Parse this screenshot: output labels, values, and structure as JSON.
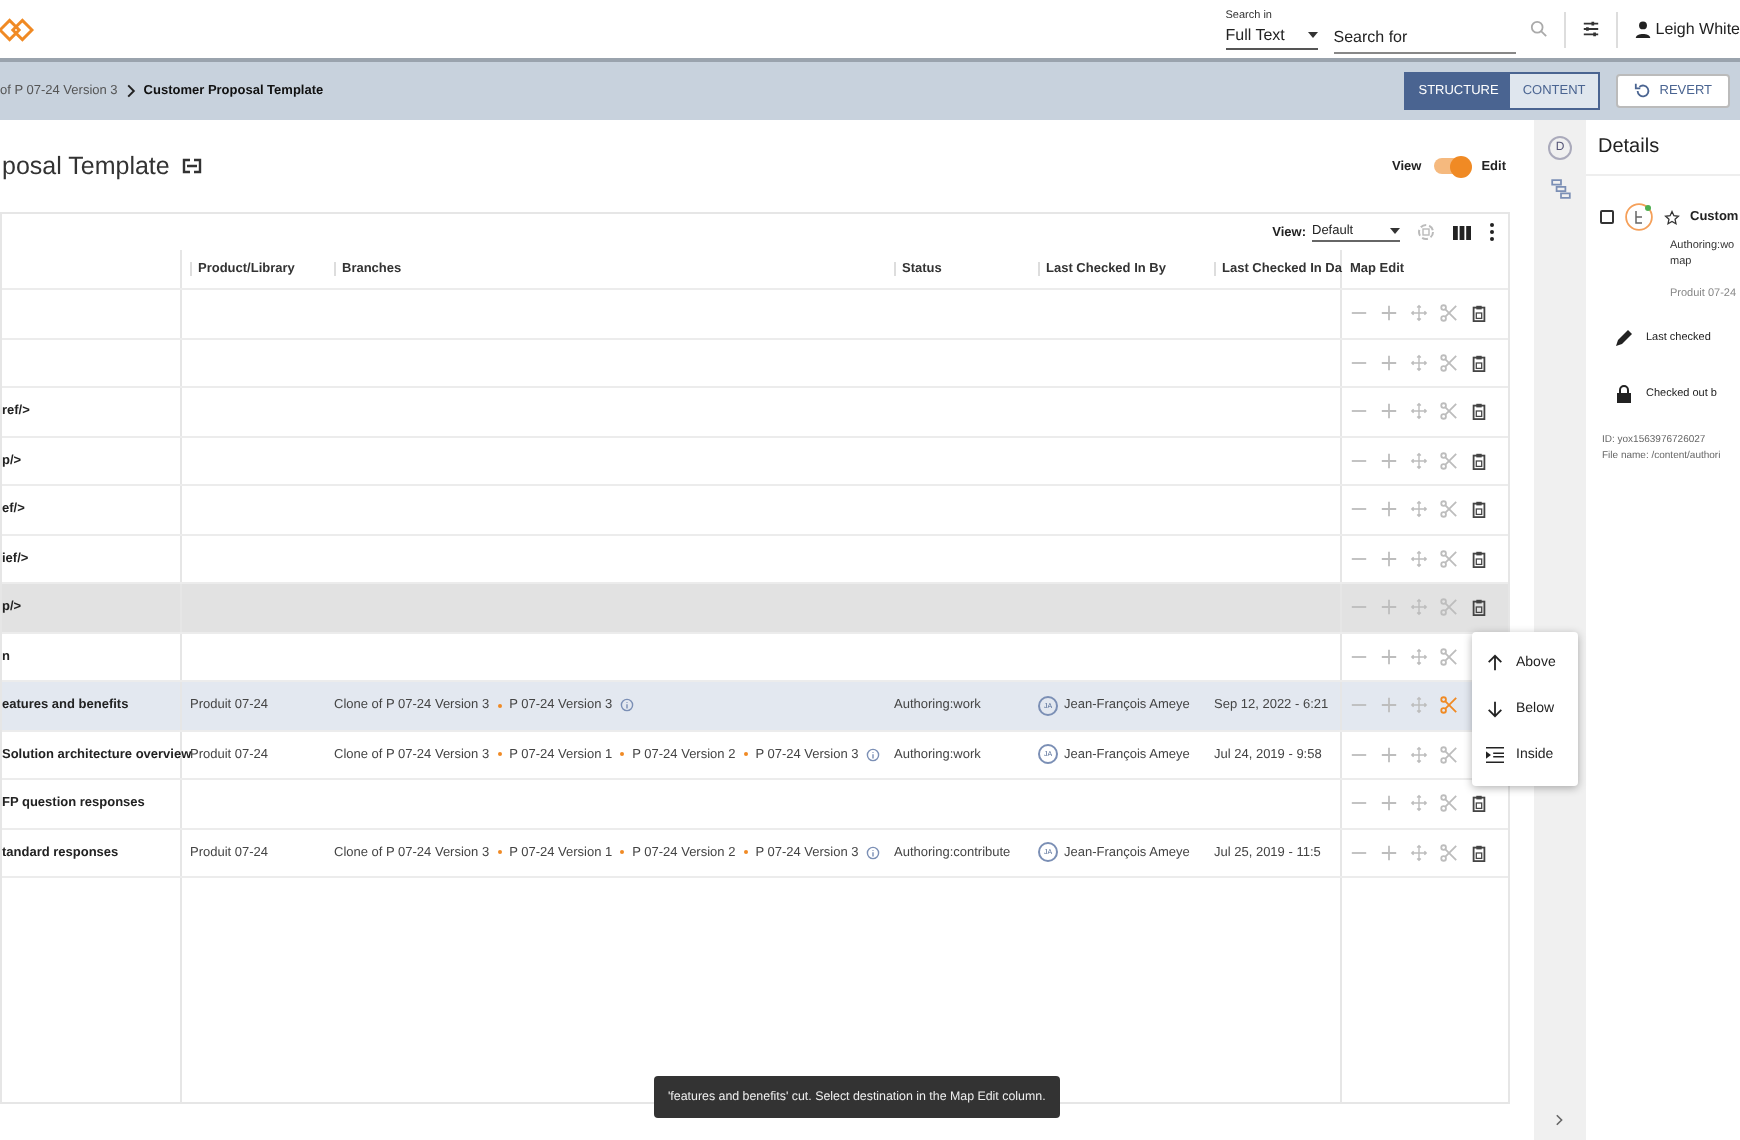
{
  "app_bar": {
    "search_label": "Search in",
    "search_scope": "Full Text",
    "search_placeholder": "Search for",
    "user_name": "Leigh White"
  },
  "breadcrumb": [
    {
      "label": "of P 07-24 Version 3",
      "current": false
    },
    {
      "label": "Customer Proposal Template",
      "current": true
    }
  ],
  "mode_tabs": [
    {
      "label": "STRUCTURE",
      "selected": true
    },
    {
      "label": "CONTENT",
      "selected": false
    }
  ],
  "revert_button": "REVERT",
  "page_title": "posal Template",
  "view_toggle": {
    "left_label": "View",
    "right_label": "Edit",
    "on": true
  },
  "table": {
    "view_label": "View:",
    "view_value": "Default",
    "columns": [
      "Product/Library",
      "Branches",
      "Status",
      "Last Checked In By",
      "Last Checked In Da",
      "Map Edit"
    ],
    "rows": [
      {
        "highlighted": false,
        "selected": false,
        "cut": false
      },
      {
        "highlighted": false,
        "selected": false,
        "cut": false
      },
      {
        "name": "ref/>",
        "highlighted": false,
        "selected": false,
        "cut": false
      },
      {
        "name": "p/>",
        "highlighted": false,
        "selected": false,
        "cut": false
      },
      {
        "name": "ef/>",
        "highlighted": false,
        "selected": false,
        "cut": false
      },
      {
        "name": "ief/>",
        "highlighted": false,
        "selected": false,
        "cut": false
      },
      {
        "name": "p/>",
        "highlighted": true,
        "selected": false,
        "cut": false
      },
      {
        "name": "n",
        "highlighted": false,
        "selected": false,
        "cut": false
      },
      {
        "name": "eatures and benefits",
        "product": "Produit 07-24",
        "branches": [
          "Clone of P 07-24 Version 3",
          "P 07-24 Version 3"
        ],
        "status": "Authoring:work",
        "initials": "JA",
        "checked_by": "Jean-François Ameye",
        "checked_date": "Sep 12, 2022 - 6:21",
        "highlighted": false,
        "selected": true,
        "cut": true
      },
      {
        "name": "Solution architecture overview",
        "product": "Produit 07-24",
        "branches": [
          "Clone of P 07-24 Version 3",
          "P 07-24 Version 1",
          "P 07-24 Version 2",
          "P 07-24 Version 3"
        ],
        "status": "Authoring:work",
        "initials": "JA",
        "checked_by": "Jean-François Ameye",
        "checked_date": "Jul 24, 2019 - 9:58",
        "highlighted": false,
        "selected": false,
        "cut": false
      },
      {
        "name": "FP question responses",
        "highlighted": false,
        "selected": false,
        "cut": false
      },
      {
        "name": "tandard responses",
        "product": "Produit 07-24",
        "branches": [
          "Clone of P 07-24 Version 3",
          "P 07-24 Version 1",
          "P 07-24 Version 2",
          "P 07-24 Version 3"
        ],
        "status": "Authoring:contribute",
        "initials": "JA",
        "checked_by": "Jean-François Ameye",
        "checked_date": "Jul 25, 2019 - 11:5",
        "highlighted": false,
        "selected": false,
        "cut": false
      }
    ]
  },
  "paste_menu": [
    {
      "label": "Above",
      "kind": "above"
    },
    {
      "label": "Below",
      "kind": "below"
    },
    {
      "label": "Inside",
      "kind": "inside"
    }
  ],
  "toast": "'features and benefits' cut. Select destination in the Map Edit column.",
  "rail": {
    "details_letter": "D"
  },
  "details": {
    "title": "Details",
    "item": {
      "checked": false,
      "name": "Custom",
      "status": "Authoring:wo",
      "type": "map",
      "product": "Produit 07-24",
      "last_checked": "Last checked",
      "checked_out": "Checked out b"
    },
    "id_line": "ID: yox1563976726027",
    "file_line": "File name: /content/authori"
  }
}
